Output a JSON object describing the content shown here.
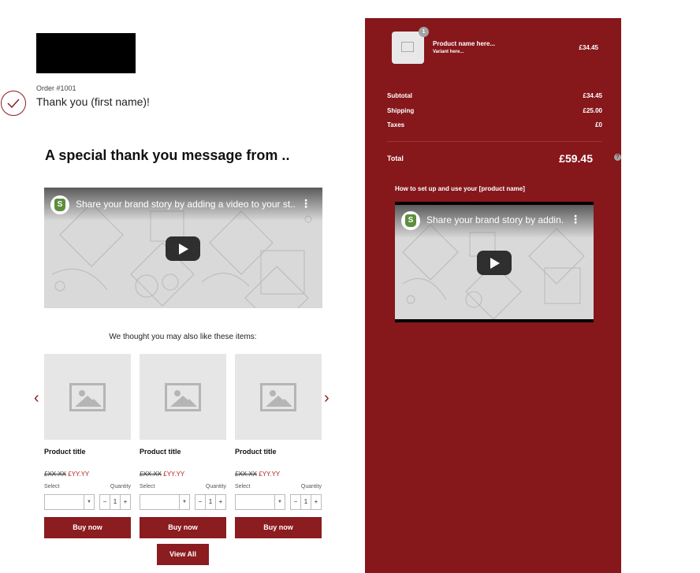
{
  "order": {
    "number_label": "Order #1001",
    "thanks_text": "Thank you (first name)!"
  },
  "special_message": {
    "heading": "A special thank you message from .."
  },
  "video_main": {
    "title": "Share your brand story by adding a video to your st...",
    "menu_glyph": "⋮"
  },
  "recommendations": {
    "heading": "We thought you may also like these items:",
    "prev_arrow": "‹",
    "next_arrow": "›",
    "items": [
      {
        "title": "Product title",
        "compare_price": "£XX.XX",
        "price": "£YY.YY",
        "select_label": "Select",
        "quantity_label": "Quantity",
        "quantity": "1",
        "minus": "−",
        "plus": "+",
        "button": "Buy now"
      },
      {
        "title": "Product title",
        "compare_price": "£XX.XX",
        "price": "£YY.YY",
        "select_label": "Select",
        "quantity_label": "Quantity",
        "quantity": "1",
        "minus": "−",
        "plus": "+",
        "button": "Buy now"
      },
      {
        "title": "Product title",
        "compare_price": "£XX.XX",
        "price": "£YY.YY",
        "select_label": "Select",
        "quantity_label": "Quantity",
        "quantity": "1",
        "minus": "−",
        "plus": "+",
        "button": "Buy now"
      }
    ],
    "view_all": "View All"
  },
  "summary": {
    "line_item": {
      "quantity_badge": "1",
      "name": "Product name here...",
      "variant": "Variant here...",
      "price": "£34.45"
    },
    "subtotal_label": "Subtotal",
    "subtotal_value": "£34.45",
    "shipping_label": "Shipping",
    "shipping_value": "£25.00",
    "taxes_label": "Taxes",
    "taxes_value": "£0",
    "total_label": "Total",
    "total_value": "£59.45",
    "help_glyph": "?"
  },
  "howto": {
    "heading": "How to set up and use your [product name]",
    "video_title": "Share your brand story by addin...",
    "menu_glyph": "⋮"
  },
  "colors": {
    "brand": "#86171b",
    "button": "#8b1c20",
    "sale_price": "#b52020",
    "placeholder": "#e6e6e6"
  },
  "icons": [
    "check-circle-icon",
    "play-icon",
    "shopify-logo-icon",
    "image-placeholder-icon",
    "chevron-left-icon",
    "chevron-right-icon",
    "help-icon",
    "caret-down-icon"
  ]
}
